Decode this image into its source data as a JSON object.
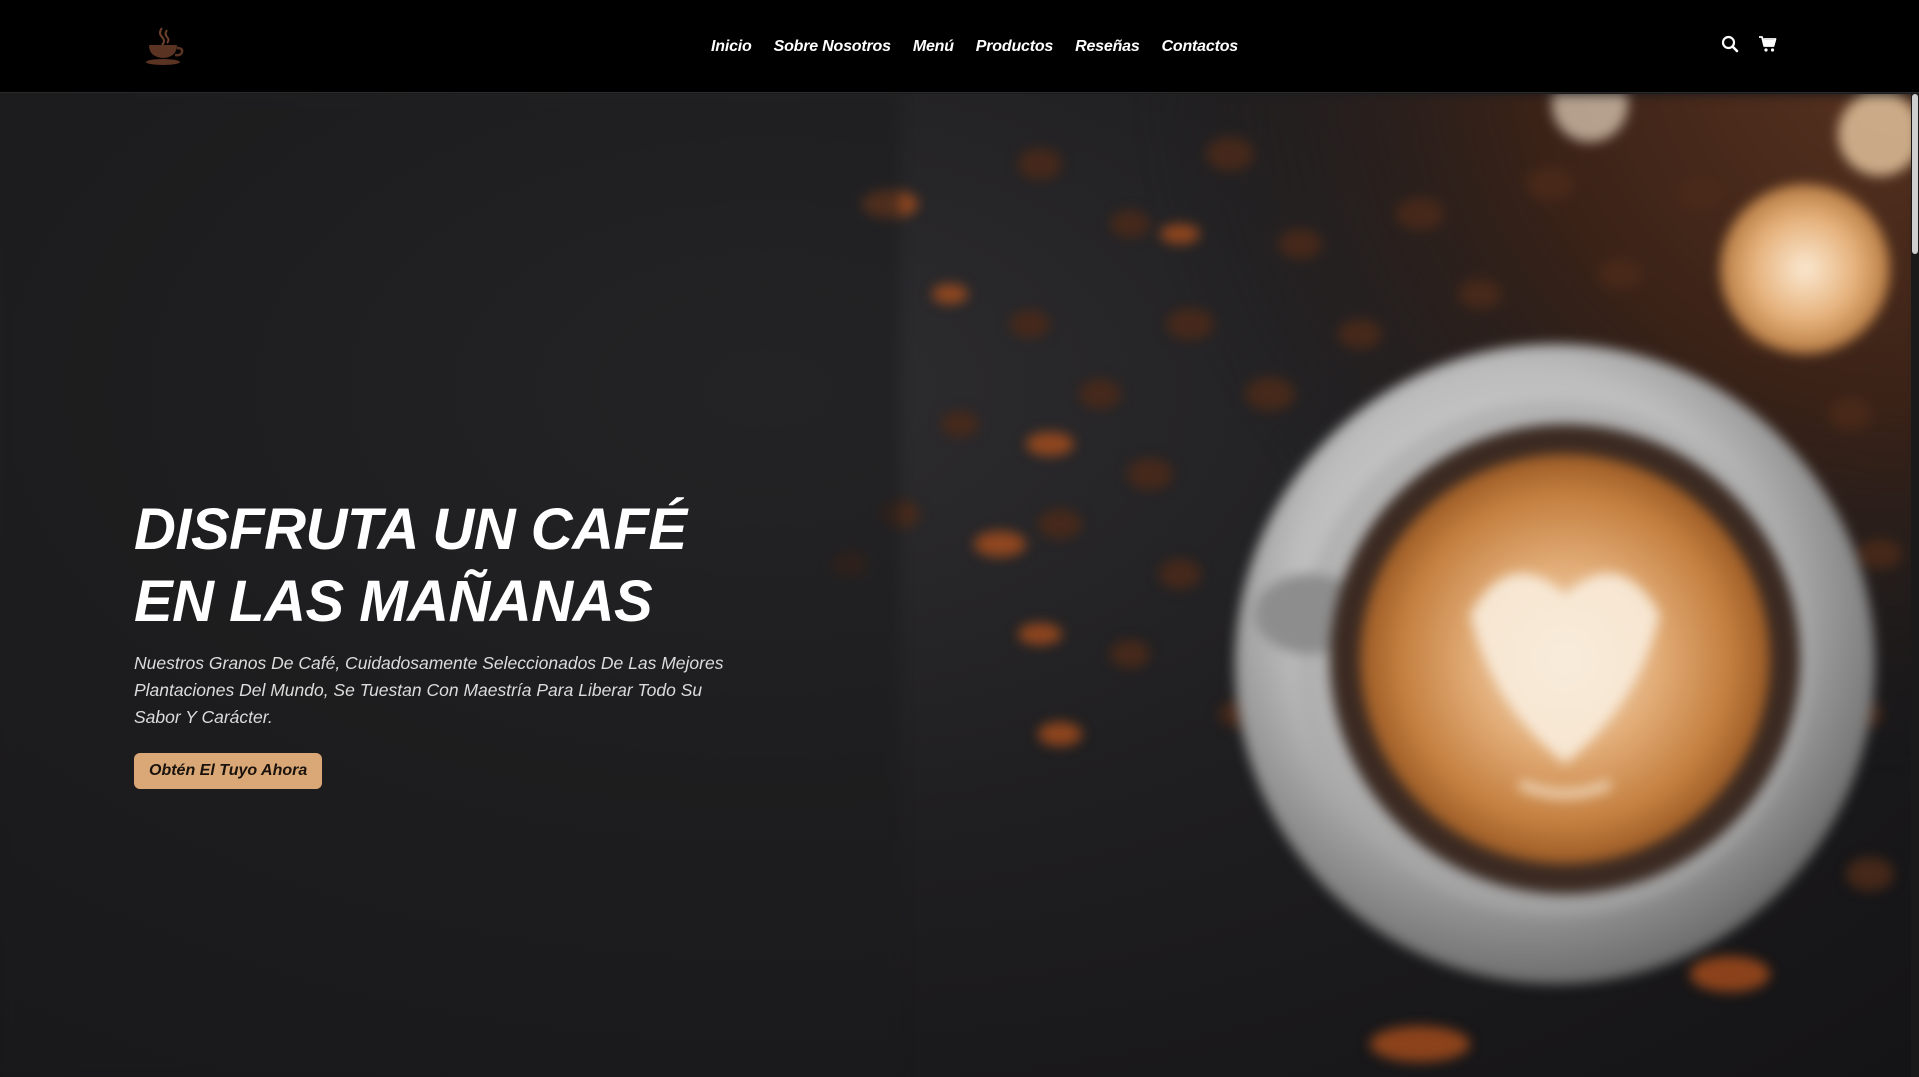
{
  "header": {
    "logo_icon": "coffee-cup-icon",
    "nav": [
      {
        "label": "Inicio"
      },
      {
        "label": "Sobre Nosotros"
      },
      {
        "label": "Menú"
      },
      {
        "label": "Productos"
      },
      {
        "label": "Reseñas"
      },
      {
        "label": "Contactos"
      }
    ],
    "icons": [
      "search-icon",
      "cart-icon"
    ]
  },
  "hero": {
    "title_line1": "DISFRUTA UN CAFÉ",
    "title_line2": "EN LAS MAÑANAS",
    "description": "Nuestros Granos De Café, Cuidadosamente Seleccionados De Las Mejores Plantaciones Del Mundo, Se Tuestan Con Maestría Para Liberar Todo Su Sabor Y Carácter.",
    "cta_label": "Obtén El Tuyo Ahora"
  },
  "colors": {
    "header_bg": "#000000",
    "accent": "#d9a876",
    "text": "#ffffff"
  }
}
